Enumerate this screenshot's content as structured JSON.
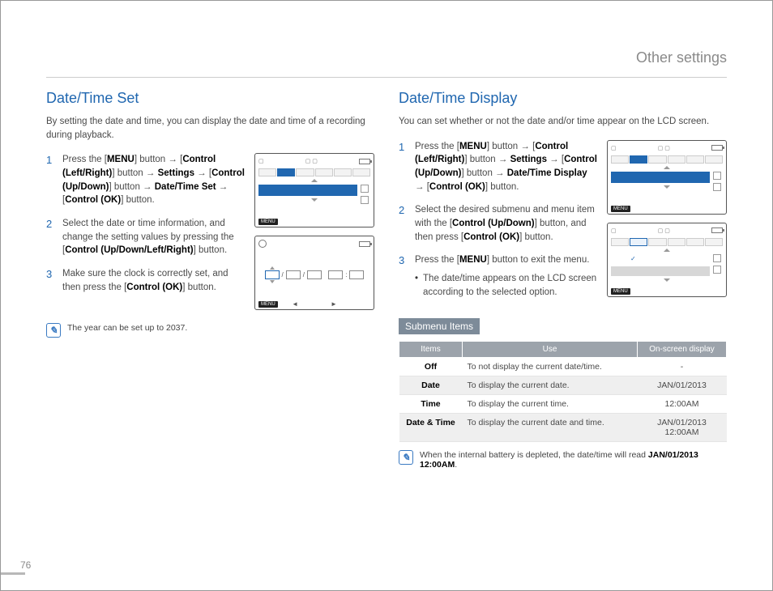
{
  "header": {
    "title": "Other settings"
  },
  "page_number": "76",
  "left": {
    "heading": "Date/Time Set",
    "intro": "By setting the date and time, you can display the date and time of a recording during playback.",
    "steps": {
      "1": {
        "p1a": "Press the [",
        "p1b": "MENU",
        "p1c": "] button",
        "p2a": "[",
        "p2b": "Control (Left/Right)",
        "p2c": "] button",
        "p3a": "Settings",
        "p3b": " → [",
        "p3c": "Control (Up/Down)",
        "p3d": "] button",
        "p4a": "Date/Time Set",
        "p4b": " → [",
        "p4c": "Control (OK)",
        "p4d": "] button."
      },
      "2": {
        "t1": "Select the date or time information, and change the setting values by pressing the [",
        "b1": "Control (Up/Down/Left/Right)",
        "t2": "] button."
      },
      "3": {
        "t1": "Make sure the clock is correctly set, and then press the [",
        "b1": "Control (OK)",
        "t2": "] button."
      }
    },
    "note": "The year can be set up to 2037.",
    "fig": {
      "menu_label": "MENU",
      "date_slash": "/",
      "time_colon": ":",
      "arrow_left": "◄",
      "arrow_right": "►"
    }
  },
  "right": {
    "heading": "Date/Time Display",
    "intro": "You can set whether or not the date and/or time appear on the LCD screen.",
    "steps": {
      "1": {
        "p1a": "Press the [",
        "p1b": "MENU",
        "p1c": "] button",
        "p2a": "[",
        "p2b": "Control (Left/Right)",
        "p2c": "] button",
        "p3a": "Settings",
        "p3b": " → [",
        "p3c": "Control (Up/Down)",
        "p3d": "] button",
        "p4a": "Date/Time Display",
        "p4b": " → [",
        "p4c": "Control (OK)",
        "p4d": "] button."
      },
      "2": {
        "t1": "Select the desired submenu and menu item with the [",
        "b1": "Control (Up/Down)",
        "t2": "] button, and then press [",
        "b2": "Control (OK)",
        "t3": "] button."
      },
      "3": {
        "t1": "Press the [",
        "b1": "MENU",
        "t2": "] button to exit the menu.",
        "bullet": "The date/time appears on the LCD screen according to the selected option."
      }
    },
    "submenu_label": "Submenu Items",
    "table": {
      "head": {
        "c1": "Items",
        "c2": "Use",
        "c3": "On-screen display"
      },
      "rows": [
        {
          "item": "Off",
          "use": "To not display the current date/time.",
          "disp": "-"
        },
        {
          "item": "Date",
          "use": "To display the current date.",
          "disp": "JAN/01/2013"
        },
        {
          "item": "Time",
          "use": "To display the current time.",
          "disp": "12:00AM"
        },
        {
          "item": "Date & Time",
          "use": "To display the current date and time.",
          "disp": "JAN/01/2013 12:00AM"
        }
      ]
    },
    "note_a": "When the internal battery is depleted, the date/time will read ",
    "note_b": "JAN/01/2013 12:00AM",
    "note_c": ".",
    "fig": {
      "menu_label": "MENU",
      "check": "✓"
    }
  }
}
